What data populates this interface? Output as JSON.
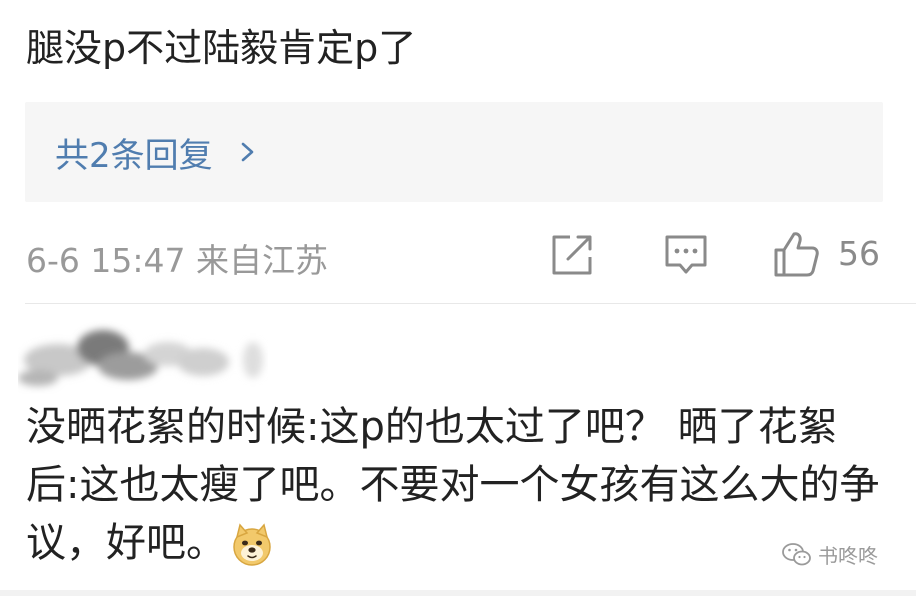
{
  "comment_top": {
    "text": "腿没p不过陆毅肯定p了"
  },
  "replies": {
    "label": "共2条回复",
    "chevron_icon": "chevron-right-icon",
    "text_color": "#507daf"
  },
  "meta": {
    "timestamp_location": "6-6 15:47 来自江苏",
    "share_icon": "share-icon",
    "comment_icon": "comment-icon",
    "like_icon": "thumbs-up-icon",
    "like_count": "56"
  },
  "comment_second": {
    "avatar": "blurred-avatar",
    "text": "没晒花絮的时候:这p的也太过了吧？ 晒了花絮后:这也太瘦了吧。不要对一个女孩有这么大的争议，好吧。",
    "emoji_icon": "doge-emoji-icon"
  },
  "watermark": {
    "text": "书咚咚",
    "icon": "wechat-icon"
  }
}
